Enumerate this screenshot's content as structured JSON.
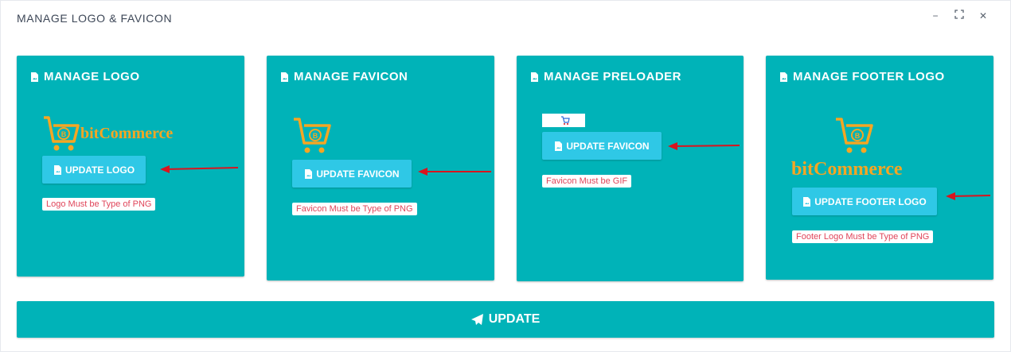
{
  "window": {
    "title": "MANAGE LOGO & FAVICON",
    "controls": {
      "minimize": "−",
      "maximize": "⛶",
      "close": "✕"
    }
  },
  "cards": {
    "logo": {
      "title": "MANAGE LOGO",
      "button": "UPDATE LOGO",
      "note": "Logo Must be Type of PNG",
      "brand_text": "bitCommerce"
    },
    "favicon": {
      "title": "MANAGE FAVICON",
      "button": "UPDATE FAVICON",
      "note": "Favicon Must be Type of PNG"
    },
    "preloader": {
      "title": "MANAGE PRELOADER",
      "button": "UPDATE FAVICON",
      "note": "Favicon Must be GIF"
    },
    "footer": {
      "title": "MANAGE FOOTER LOGO",
      "button": "UPDATE FOOTER LOGO",
      "note": "Footer Logo Must be Type of PNG",
      "brand_text": "bitCommerce"
    }
  },
  "update_button": "UPDATE",
  "colors": {
    "card_bg": "#00b3b8",
    "button_bg": "#2fc8e6",
    "note_text": "#e0455a",
    "arrow": "#d9141e",
    "logo_orange": "#f5a623"
  },
  "icons": [
    "file-image-icon",
    "paper-plane-icon",
    "cart-logo-icon",
    "arrow-icon"
  ]
}
